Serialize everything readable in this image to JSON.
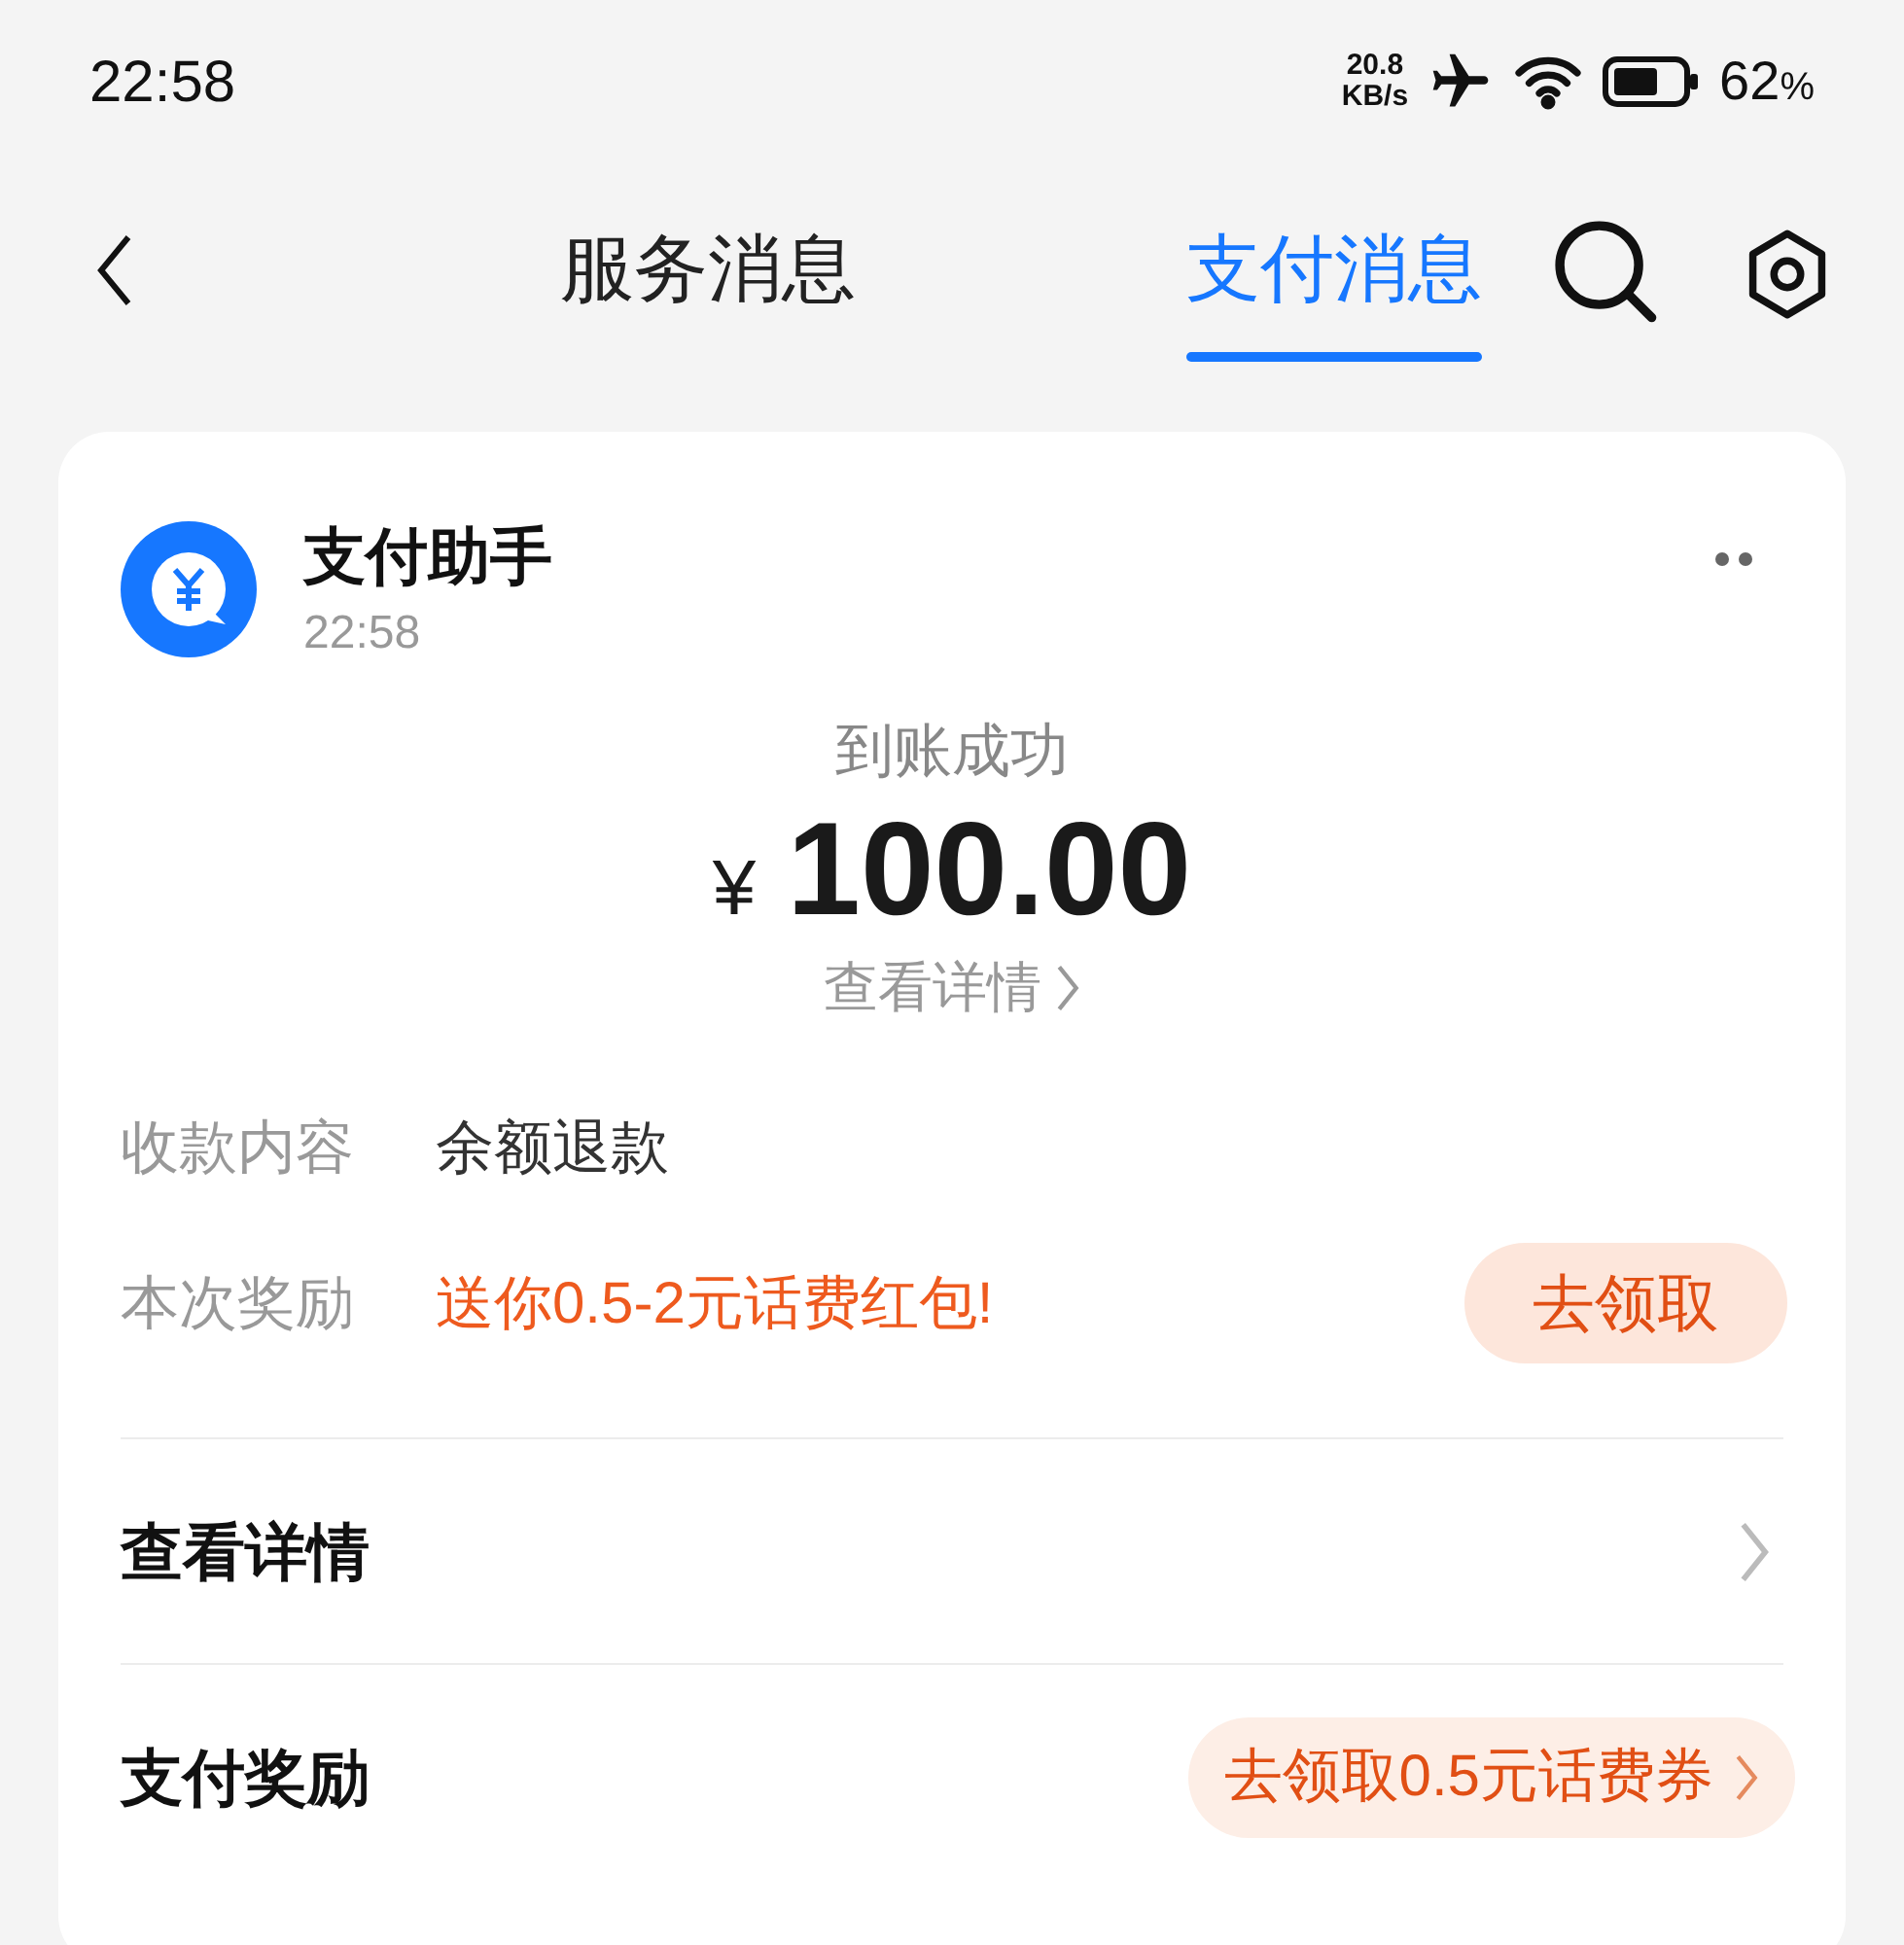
{
  "status_bar": {
    "time": "22:58",
    "speed": "20.8",
    "speed_unit": "KB/s",
    "battery_level": "62",
    "battery_unit": "%"
  },
  "tabs": [
    {
      "label": "服务消息",
      "selected": false
    },
    {
      "label": "支付消息",
      "selected": true
    }
  ],
  "message": {
    "sender": "支付助手",
    "time": "22:58",
    "status": "到账成功",
    "currency": "¥",
    "amount": "100.00",
    "details_link": "查看详情",
    "fields": [
      {
        "kind": "text",
        "label": "收款内容",
        "value": "余额退款"
      },
      {
        "kind": "reward",
        "label": "本次奖励",
        "value": "送你0.5-2元话费红包!",
        "action": "去领取"
      }
    ],
    "rows": [
      {
        "label": "查看详情"
      },
      {
        "label": "支付奖励",
        "action": "去领取0.5元话费券"
      }
    ]
  }
}
